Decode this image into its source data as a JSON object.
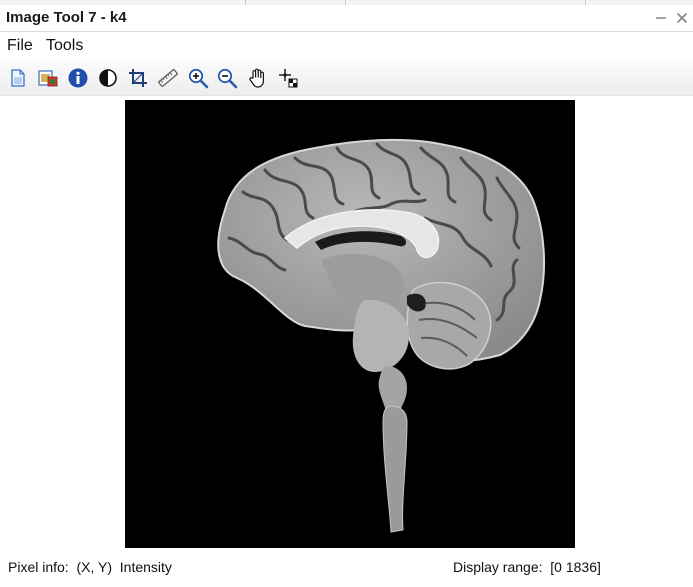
{
  "window": {
    "title": "Image Tool 7 - k4"
  },
  "menu": {
    "items": [
      {
        "label": "File"
      },
      {
        "label": "Tools"
      }
    ]
  },
  "toolbar": {
    "tools": [
      {
        "icon": "new-figure-icon"
      },
      {
        "icon": "export-icon"
      },
      {
        "icon": "info-icon"
      },
      {
        "icon": "contrast-icon"
      },
      {
        "icon": "crop-icon"
      },
      {
        "icon": "ruler-icon"
      },
      {
        "icon": "zoom-in-icon"
      },
      {
        "icon": "zoom-out-icon"
      },
      {
        "icon": "pan-hand-icon"
      },
      {
        "icon": "pixel-region-icon"
      }
    ]
  },
  "status": {
    "pixel_info_label": "Pixel info:",
    "pixel_info_value": "(X, Y)  Intensity",
    "display_range_label": "Display range:",
    "display_range_value": "[0 1836]"
  },
  "colors": {
    "viewer_background": "#000000",
    "info_icon": "#1f4fa8",
    "zoom_icon": "#2a5bb0"
  }
}
